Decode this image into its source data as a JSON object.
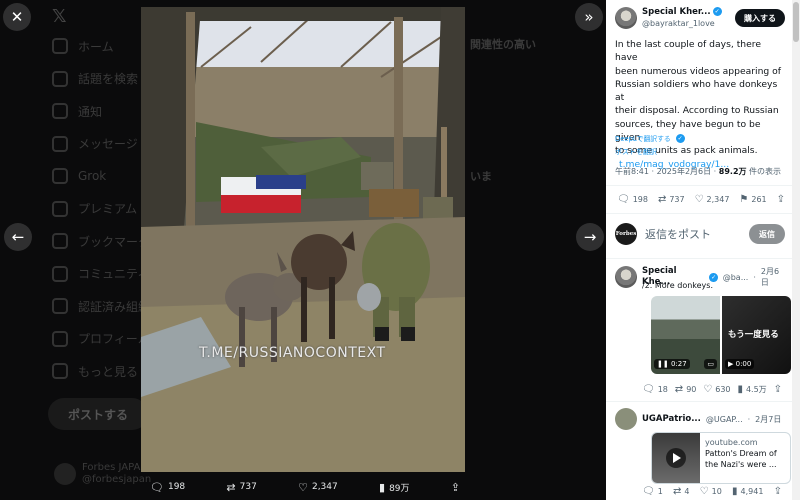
{
  "background": {
    "nav_items": [
      "ホーム",
      "話題を検索",
      "通知",
      "メッセージ",
      "Grok",
      "プレミアム",
      "ブックマーク",
      "コミュニティ",
      "認証済み組織",
      "プロフィール",
      "もっと見る"
    ],
    "post_button": "ポストする",
    "account_name": "Forbes JAPAN",
    "account_handle": "@forbesjapan",
    "right_heading": "関連性の高い",
    "right_snippet": "いま"
  },
  "viewer": {
    "watermark": "T.ME/RUSSIANOCONTEXT",
    "actions": {
      "replies": "198",
      "reposts": "737",
      "likes": "2,347",
      "views": "89万"
    }
  },
  "panel": {
    "author": {
      "name": "Special Kher...",
      "handle": "@bayraktar_1love",
      "buy_label": "購入する"
    },
    "body_lines": [
      "In the last couple of days, there have",
      "been numerous videos appearing of",
      "Russian soldiers who have donkeys at",
      "their disposal. According to Russian",
      "sources, they have begun to be given",
      "to some units as pack animals."
    ],
    "link": "t.me/mag_vodogray/1...",
    "deepl": "DeepLで翻訳する",
    "translate": "ポストを翻訳",
    "time": "午前8:41 · 2025年2月6日 · ",
    "views_num": "89.2万",
    "views_suffix": " 件の表示",
    "stats": {
      "replies": "198",
      "reposts": "737",
      "likes": "2,347",
      "bookmarks": "261"
    },
    "reply_avatar": "Forbes",
    "reply_placeholder": "返信をポスト",
    "reply_button": "返信",
    "reply1": {
      "name": "Special Khe...",
      "handle": "@ba...",
      "date": "2月6日",
      "text": "/2. More donkeys.",
      "video_time1": "0:27",
      "video_time2": "0:00",
      "replay": "もう一度見る",
      "stats": {
        "replies": "18",
        "reposts": "90",
        "likes": "630",
        "views": "4.5万"
      }
    },
    "reply2": {
      "name": "UGAPatrio...",
      "handle": "@UGAP...",
      "date": "2月7日",
      "card_domain": "youtube.com",
      "card_title1": "Patton's Dream of",
      "card_title2": "the Nazi's were ...",
      "stats": {
        "replies": "1",
        "reposts": "4",
        "likes": "10",
        "views": "4,941"
      }
    }
  }
}
